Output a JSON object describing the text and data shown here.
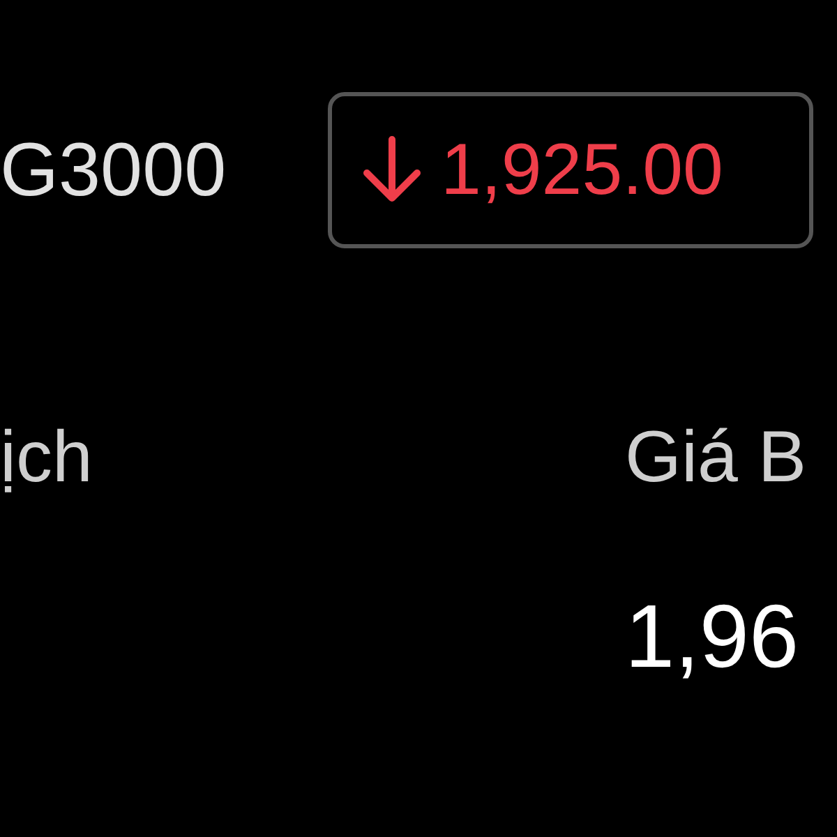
{
  "header": {
    "symbol": "G3000",
    "price": {
      "kind": "down",
      "value": "1,925.00"
    }
  },
  "columns": [
    {
      "label": "ịch"
    },
    {
      "label": "Giá B",
      "value": "1,96"
    }
  ]
}
